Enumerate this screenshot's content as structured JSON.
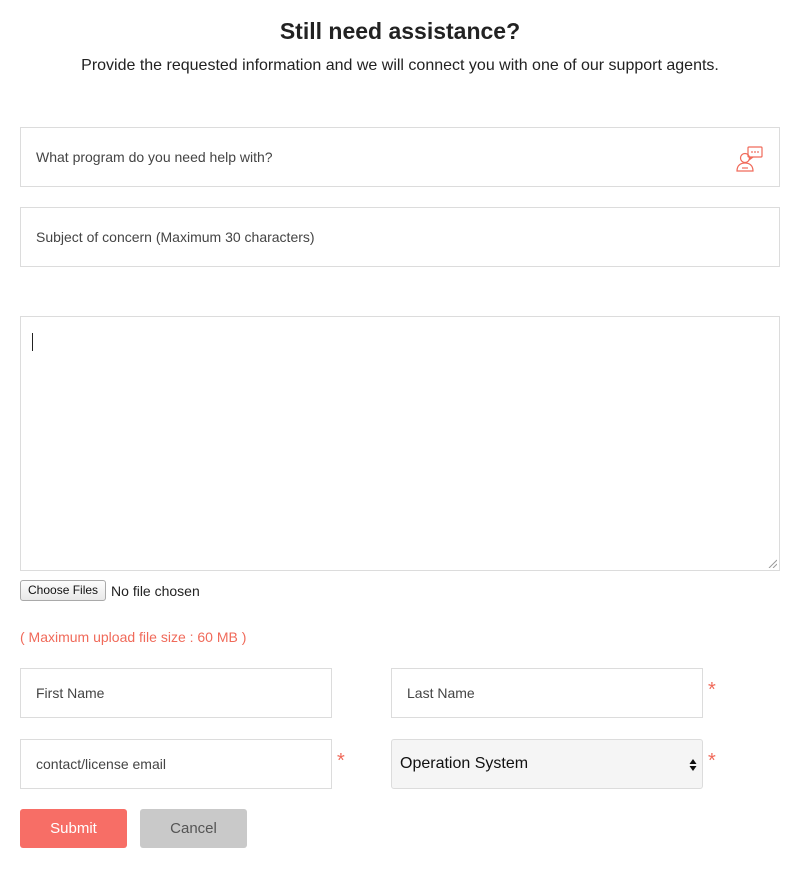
{
  "header": {
    "title": "Still need assistance?",
    "subtitle": "Provide the requested information and we will connect you with one of our support agents."
  },
  "form": {
    "program_placeholder": "What program do you need help with?",
    "program_icon": "support-agent-chat-icon",
    "subject_placeholder": "Subject of concern (Maximum 30 characters)",
    "message_value": "",
    "choose_files_label": "Choose Files",
    "no_file_text": "No file chosen",
    "max_upload_text": "( Maximum upload file size : 60 MB )",
    "first_name_placeholder": "First Name",
    "last_name_placeholder": "Last Name",
    "email_placeholder": "contact/license email",
    "os_selected": "Operation System",
    "required_mark": "*",
    "submit_label": "Submit",
    "cancel_label": "Cancel"
  },
  "colors": {
    "accent": "#f76e66",
    "required": "#f06a5a",
    "cancel_bg": "#c9c9c9",
    "border": "#dcdcdc"
  }
}
